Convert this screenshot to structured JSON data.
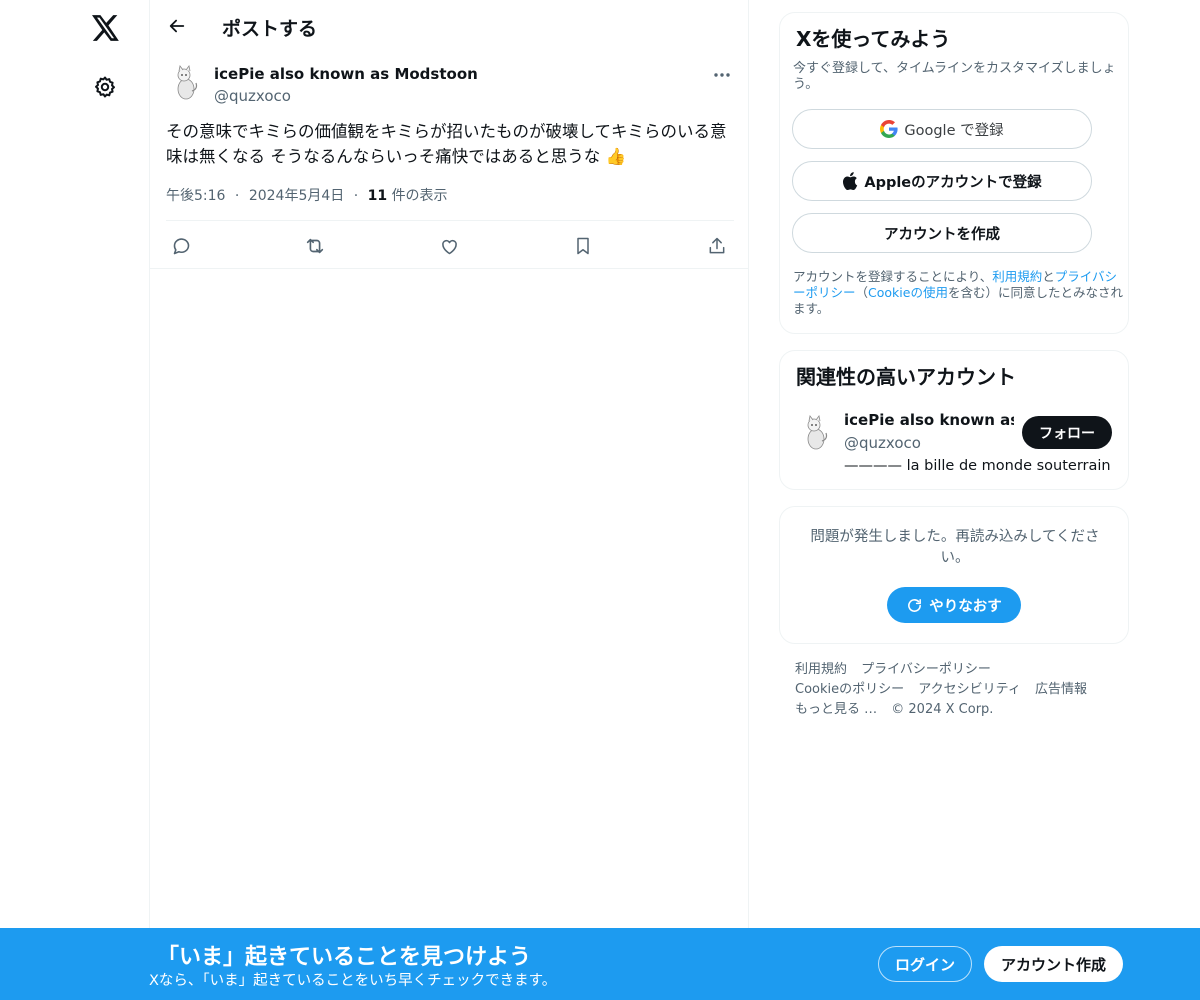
{
  "nav": {
    "logo_icon": "x-logo-icon",
    "settings_icon": "gear-icon"
  },
  "header": {
    "title": "ポストする"
  },
  "post": {
    "author_name": "icePie also known as Modstoon",
    "author_handle": "@quzxoco",
    "text": "その意味でキミらの価値観をキミらが招いたものが破壊してキミらのいる意味は無くなる そうなるんならいっそ痛快ではあると思うな 👍",
    "time": "午後5:16",
    "date": "2024年5月4日",
    "view_count": "11",
    "view_label": "件の表示",
    "separator": "·"
  },
  "signup_card": {
    "title": "Xを使ってみよう",
    "subtitle": "今すぐ登録して、タイムラインをカスタマイズしましょう。",
    "google_label": "Google で登録",
    "apple_label": "Appleのアカウントで登録",
    "create_label": "アカウントを作成",
    "legal_prefix": "アカウントを登録することにより、",
    "legal_terms": "利用規約",
    "legal_and": "と",
    "legal_privacy": "プライバシーポリシー",
    "legal_open": "（",
    "legal_cookie": "Cookieの使用",
    "legal_suffix": "を含む）に同意したとみなされます。"
  },
  "related": {
    "title": "関連性の高いアカウント",
    "name": "icePie also known as Modstoon",
    "handle": "@quzxoco",
    "bio": "———— la bille de monde souterrain",
    "follow_label": "フォロー"
  },
  "error_card": {
    "message": "問題が発生しました。再読み込みしてください。",
    "retry_label": "やりなおす"
  },
  "footer": {
    "terms": "利用規約",
    "privacy": "プライバシーポリシー",
    "cookie": "Cookieのポリシー",
    "accessibility": "アクセシビリティ",
    "ads": "広告情報",
    "more": "もっと見る …",
    "copyright": "© 2024 X Corp."
  },
  "banner": {
    "title": "「いま」起きていることを見つけよう",
    "subtitle": "Xなら、「いま」起きていることをいち早くチェックできます。",
    "login_label": "ログイン",
    "signup_label": "アカウント作成"
  },
  "colors": {
    "accent": "#1d9bf0",
    "text_primary": "#0f1419",
    "text_secondary": "#536471",
    "border": "#eff3f4"
  }
}
